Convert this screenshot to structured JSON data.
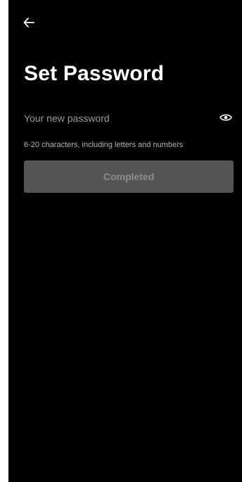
{
  "header": {
    "back_icon": "arrow-left-icon"
  },
  "page": {
    "title": "Set Password"
  },
  "password": {
    "value": "",
    "placeholder": "Your new password",
    "visibility_icon": "eye-icon"
  },
  "hint": "6-20 characters, including letters and numbers",
  "submit": {
    "label": "Completed",
    "enabled": false
  },
  "colors": {
    "background": "#000000",
    "title": "#ffffff",
    "placeholder": "#9a9a9a",
    "hint": "#b4b4b4",
    "button_disabled_bg": "#555555",
    "button_disabled_text": "#8c8c8c"
  }
}
